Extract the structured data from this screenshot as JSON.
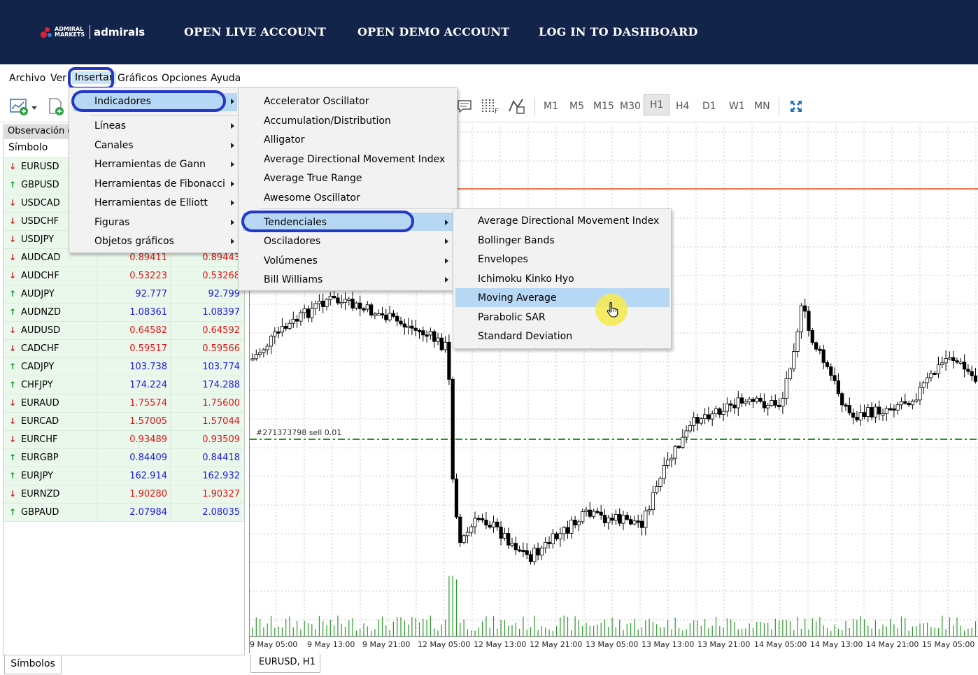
{
  "banner": {
    "logo_line1": "ADMIRAL",
    "logo_line2": "MARKETS",
    "logo_brand": "admirals",
    "links": [
      "OPEN LIVE ACCOUNT",
      "OPEN DEMO ACCOUNT",
      "LOG IN TO DASHBOARD"
    ],
    "bg_color": "#13244b"
  },
  "menubar": {
    "items": [
      "Archivo",
      "Ver",
      "Insertar",
      "Gráficos",
      "Opciones",
      "Ayuda"
    ],
    "active": "Insertar"
  },
  "toolbar": {
    "timeframes": [
      "M1",
      "M5",
      "M15",
      "M30",
      "H1",
      "H4",
      "D1",
      "W1",
      "MN"
    ],
    "selected_timeframe": "H1"
  },
  "market_watch": {
    "title": "Observación d",
    "column_symbol": "Símbolo",
    "rows": [
      {
        "dir": "down",
        "symbol": "EURUSD",
        "bid": "",
        "ask": ""
      },
      {
        "dir": "up",
        "symbol": "GBPUSD",
        "bid": "",
        "ask": ""
      },
      {
        "dir": "down",
        "symbol": "USDCAD",
        "bid": "",
        "ask": ""
      },
      {
        "dir": "down",
        "symbol": "USDCHF",
        "bid": "",
        "ask": ""
      },
      {
        "dir": "down",
        "symbol": "USDJPY",
        "bid": "",
        "ask": ""
      },
      {
        "dir": "down",
        "symbol": "AUDCAD",
        "bid": "0.89411",
        "ask": "0.89443"
      },
      {
        "dir": "down",
        "symbol": "AUDCHF",
        "bid": "0.53223",
        "ask": "0.53268"
      },
      {
        "dir": "up",
        "symbol": "AUDJPY",
        "bid": "92.777",
        "ask": "92.799"
      },
      {
        "dir": "up",
        "symbol": "AUDNZD",
        "bid": "1.08361",
        "ask": "1.08397"
      },
      {
        "dir": "down",
        "symbol": "AUDUSD",
        "bid": "0.64582",
        "ask": "0.64592"
      },
      {
        "dir": "down",
        "symbol": "CADCHF",
        "bid": "0.59517",
        "ask": "0.59566"
      },
      {
        "dir": "up",
        "symbol": "CADJPY",
        "bid": "103.738",
        "ask": "103.774"
      },
      {
        "dir": "up",
        "symbol": "CHFJPY",
        "bid": "174.224",
        "ask": "174.288"
      },
      {
        "dir": "down",
        "symbol": "EURAUD",
        "bid": "1.75574",
        "ask": "1.75600"
      },
      {
        "dir": "down",
        "symbol": "EURCAD",
        "bid": "1.57005",
        "ask": "1.57044"
      },
      {
        "dir": "down",
        "symbol": "EURCHF",
        "bid": "0.93489",
        "ask": "0.93509"
      },
      {
        "dir": "up",
        "symbol": "EURGBP",
        "bid": "0.84409",
        "ask": "0.84418"
      },
      {
        "dir": "up",
        "symbol": "EURJPY",
        "bid": "162.914",
        "ask": "162.932"
      },
      {
        "dir": "down",
        "symbol": "EURNZD",
        "bid": "1.90280",
        "ask": "1.90327"
      },
      {
        "dir": "up",
        "symbol": "GBPAUD",
        "bid": "2.07984",
        "ask": "2.08035"
      }
    ],
    "tab_label": "Símbolos"
  },
  "insert_menu": {
    "items": [
      "Indicadores",
      "Líneas",
      "Canales",
      "Herramientas de Gann",
      "Herramientas de Fibonacci",
      "Herramientas de Elliott",
      "Figuras",
      "Objetos gráficos"
    ],
    "highlighted": "Indicadores"
  },
  "indicators_menu": {
    "items": [
      "Accelerator Oscillator",
      "Accumulation/Distribution",
      "Alligator",
      "Average Directional Movement Index",
      "Average True Range",
      "Awesome Oscillator"
    ],
    "groups": [
      "Tendenciales",
      "Osciladores",
      "Volúmenes",
      "Bill Williams"
    ],
    "highlighted": "Tendenciales"
  },
  "trend_menu": {
    "items": [
      "Average Directional Movement Index",
      "Bollinger Bands",
      "Envelopes",
      "Ichimoku Kinko Hyo",
      "Moving Average",
      "Parabolic SAR",
      "Standard Deviation"
    ],
    "highlighted": "Moving Average"
  },
  "chart": {
    "tab_label": "EURUSD, H1",
    "order_label": "#271373798 sell 0.01",
    "x_labels": [
      "9 May 05:00",
      "9 May 13:00",
      "9 May 21:00",
      "12 May 05:00",
      "12 May 13:00",
      "12 May 21:00",
      "13 May 05:00",
      "13 May 13:00",
      "13 May 21:00",
      "14 May 05:00",
      "14 May 13:00",
      "14 May 21:00",
      "15 May 05:00"
    ],
    "ask_line_color": "#e0501c",
    "order_line_color": "#1a9a1a",
    "volume_color": "#2a9a2a"
  }
}
